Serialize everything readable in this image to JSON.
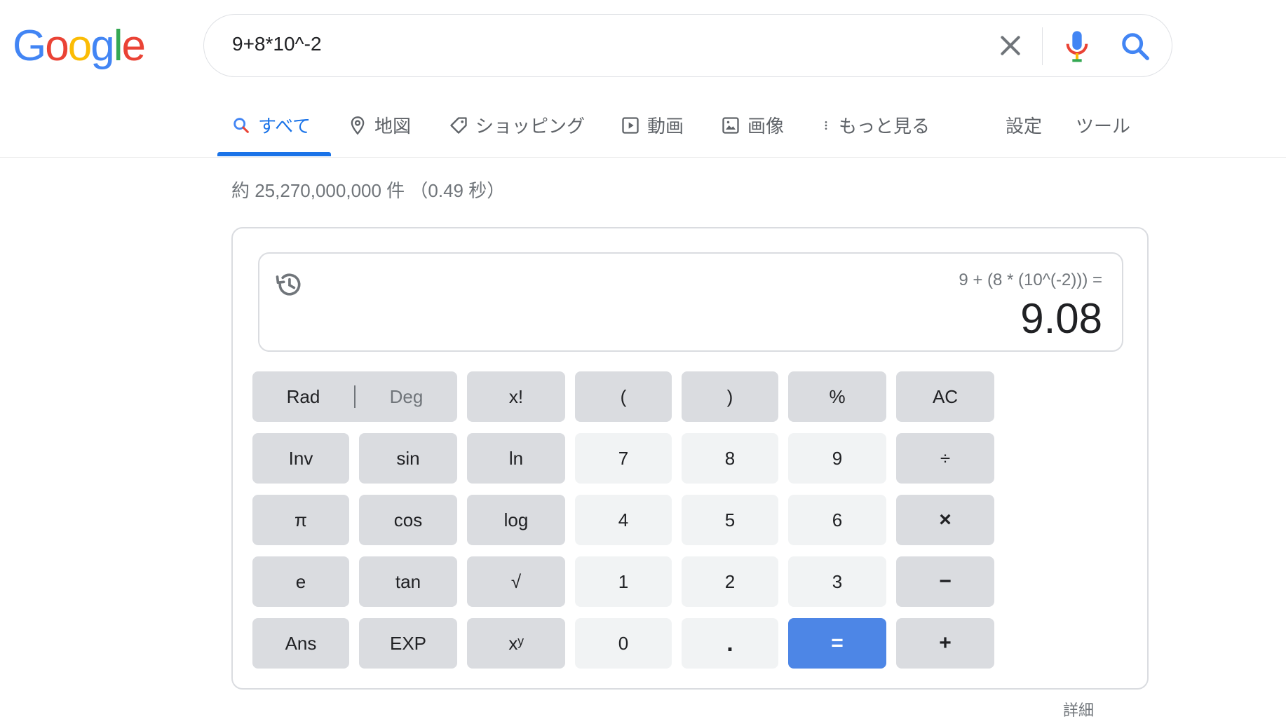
{
  "logo": {
    "letters": [
      {
        "ch": "G",
        "color": "#4285f4"
      },
      {
        "ch": "o",
        "color": "#ea4335"
      },
      {
        "ch": "o",
        "color": "#fbbc05"
      },
      {
        "ch": "g",
        "color": "#4285f4"
      },
      {
        "ch": "l",
        "color": "#34a853"
      },
      {
        "ch": "e",
        "color": "#ea4335"
      }
    ]
  },
  "search": {
    "query": "9+8*10^-2"
  },
  "tabs": [
    {
      "label": "すべて",
      "icon": "search-icon",
      "active": true
    },
    {
      "label": "地図",
      "icon": "map-pin-icon"
    },
    {
      "label": "ショッピング",
      "icon": "tag-icon"
    },
    {
      "label": "動画",
      "icon": "play-icon"
    },
    {
      "label": "画像",
      "icon": "image-icon"
    },
    {
      "label": "もっと見る",
      "icon": "more-vert-icon"
    },
    {
      "label": "設定"
    },
    {
      "label": "ツール"
    }
  ],
  "result_stats": "約 25,270,000,000 件 （0.49 秒）",
  "calculator": {
    "expression": "9 + (8 * (10^(-2))) =",
    "result": "9.08",
    "rad_label": "Rad",
    "deg_label": "Deg",
    "rows": [
      [
        {
          "l": "x!",
          "t": "fn"
        },
        {
          "l": "(",
          "t": "fn"
        },
        {
          "l": ")",
          "t": "fn"
        },
        {
          "l": "%",
          "t": "fn"
        },
        {
          "l": "AC",
          "t": "fn"
        }
      ],
      [
        {
          "l": "Inv",
          "t": "fn"
        },
        {
          "l": "sin",
          "t": "fn"
        },
        {
          "l": "ln",
          "t": "fn"
        },
        {
          "l": "7",
          "t": "num"
        },
        {
          "l": "8",
          "t": "num"
        },
        {
          "l": "9",
          "t": "num"
        },
        {
          "l": "÷",
          "t": "fn"
        }
      ],
      [
        {
          "l": "π",
          "t": "fn"
        },
        {
          "l": "cos",
          "t": "fn"
        },
        {
          "l": "log",
          "t": "fn"
        },
        {
          "l": "4",
          "t": "num"
        },
        {
          "l": "5",
          "t": "num"
        },
        {
          "l": "6",
          "t": "num"
        },
        {
          "l": "×",
          "t": "fn"
        }
      ],
      [
        {
          "l": "e",
          "t": "fn"
        },
        {
          "l": "tan",
          "t": "fn"
        },
        {
          "l": "√",
          "t": "fn"
        },
        {
          "l": "1",
          "t": "num"
        },
        {
          "l": "2",
          "t": "num"
        },
        {
          "l": "3",
          "t": "num"
        },
        {
          "l": "−",
          "t": "fn"
        }
      ],
      [
        {
          "l": "Ans",
          "t": "fn"
        },
        {
          "l": "EXP",
          "t": "fn"
        },
        {
          "l": "xʸ",
          "t": "fn"
        },
        {
          "l": "0",
          "t": "num"
        },
        {
          "l": ".",
          "t": "num"
        },
        {
          "l": "=",
          "t": "eq"
        },
        {
          "l": "+",
          "t": "fn"
        }
      ]
    ]
  },
  "more_link": "詳細",
  "colors": {
    "accent": "#1a73e8",
    "equals": "#4d86e6"
  }
}
